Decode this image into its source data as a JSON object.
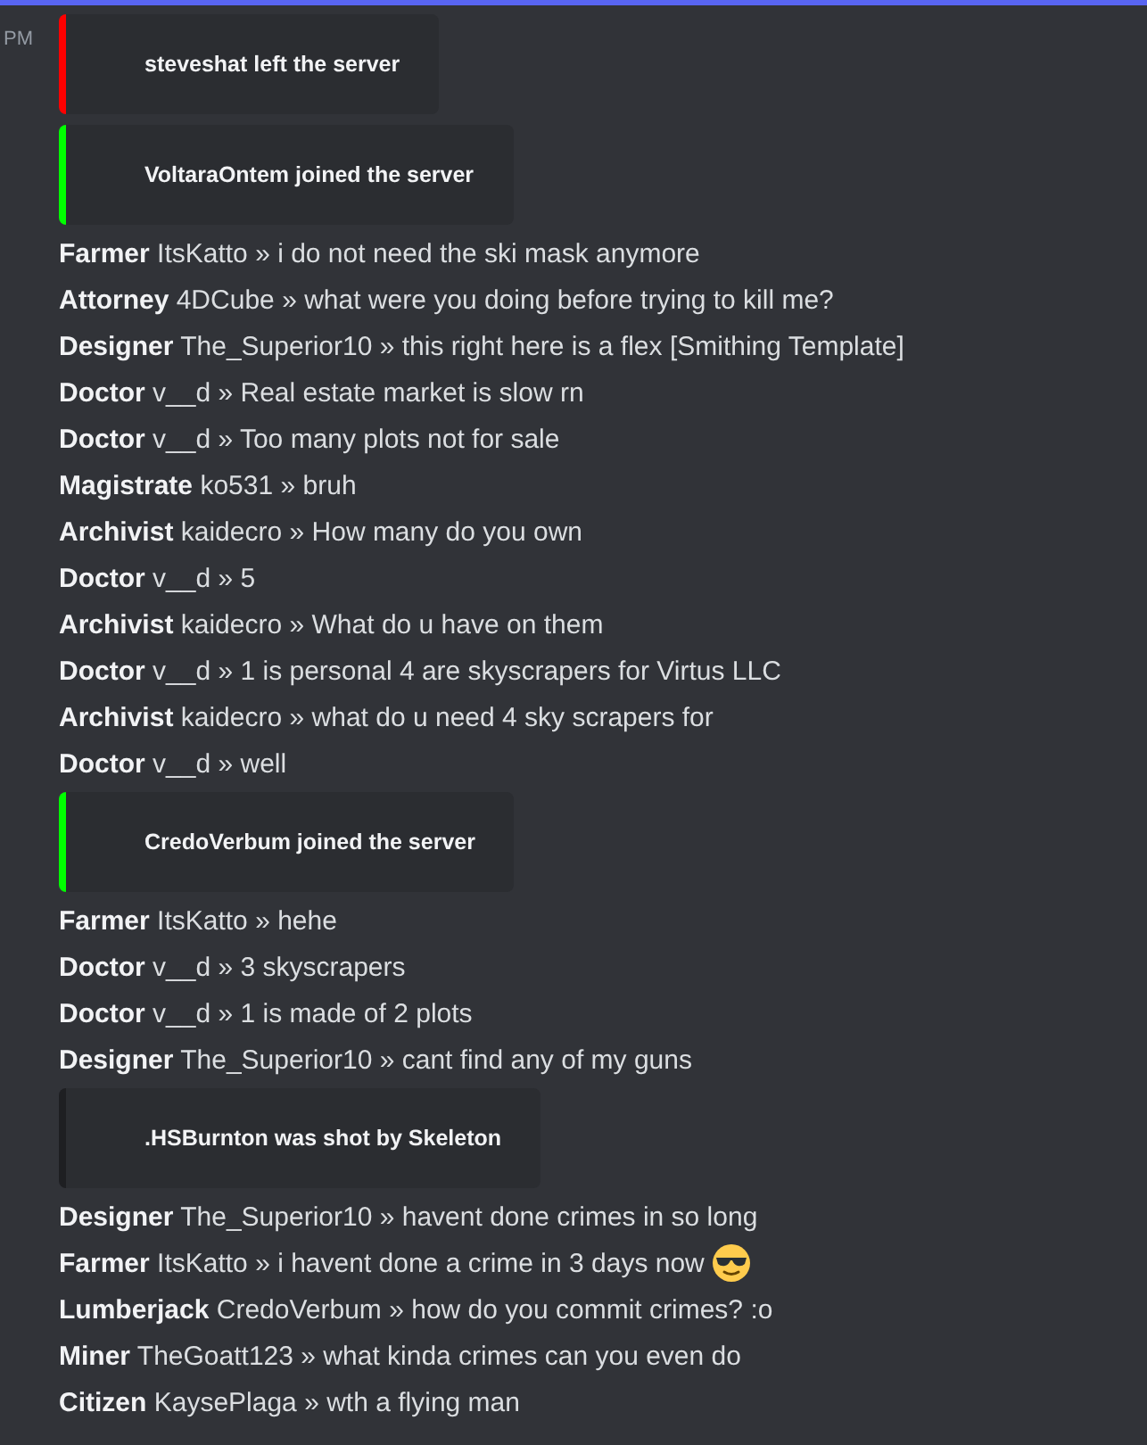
{
  "timestamp": "PM",
  "items": [
    {
      "kind": "embed",
      "text": "steveshat left the server",
      "color": "#ff0000"
    },
    {
      "kind": "embed",
      "text": "VoltaraOntem joined the server",
      "color": "#00ff00"
    },
    {
      "kind": "message",
      "role": "Farmer",
      "user": "ItsKatto",
      "separator": "»",
      "text": "i do not need the ski mask anymore"
    },
    {
      "kind": "message",
      "role": "Attorney",
      "user": "4DCube",
      "separator": "»",
      "text": "what were you doing before trying to kill me?"
    },
    {
      "kind": "message",
      "role": "Designer",
      "user": "The_Superior10",
      "separator": "»",
      "text": "this right here is a flex [Smithing Template]"
    },
    {
      "kind": "message",
      "role": "Doctor",
      "user": "v__d",
      "separator": "»",
      "text": "Real estate market is slow rn"
    },
    {
      "kind": "message",
      "role": "Doctor",
      "user": "v__d",
      "separator": "»",
      "text": "Too many plots not for sale"
    },
    {
      "kind": "message",
      "role": "Magistrate",
      "user": "ko531",
      "separator": "»",
      "text": "bruh"
    },
    {
      "kind": "message",
      "role": "Archivist",
      "user": "kaidecro",
      "separator": "»",
      "text": "How many do you own"
    },
    {
      "kind": "message",
      "role": "Doctor",
      "user": "v__d",
      "separator": "»",
      "text": "5"
    },
    {
      "kind": "message",
      "role": "Archivist",
      "user": "kaidecro",
      "separator": "»",
      "text": "What do u have on them"
    },
    {
      "kind": "message",
      "role": "Doctor",
      "user": "v__d",
      "separator": "»",
      "text": "1 is personal 4 are skyscrapers for Virtus LLC"
    },
    {
      "kind": "message",
      "role": "Archivist",
      "user": "kaidecro",
      "separator": "»",
      "text": "what do u need 4 sky scrapers for"
    },
    {
      "kind": "message",
      "role": "Doctor",
      "user": "v__d",
      "separator": "»",
      "text": "well"
    },
    {
      "kind": "embed",
      "text": "CredoVerbum joined the server",
      "color": "#00ff00"
    },
    {
      "kind": "message",
      "role": "Farmer",
      "user": "ItsKatto",
      "separator": "»",
      "text": "hehe"
    },
    {
      "kind": "message",
      "role": "Doctor",
      "user": "v__d",
      "separator": "»",
      "text": "3 skyscrapers"
    },
    {
      "kind": "message",
      "role": "Doctor",
      "user": "v__d",
      "separator": "»",
      "text": "1 is made of 2 plots"
    },
    {
      "kind": "message",
      "role": "Designer",
      "user": "The_Superior10",
      "separator": "»",
      "text": "cant find any of my guns"
    },
    {
      "kind": "embed",
      "text": ".HSBurnton was shot by Skeleton",
      "color": "#1e1f22"
    },
    {
      "kind": "message",
      "role": "Designer",
      "user": "The_Superior10",
      "separator": "»",
      "text": "havent done crimes in so long"
    },
    {
      "kind": "message",
      "role": "Farmer",
      "user": "ItsKatto",
      "separator": "»",
      "text": "i havent done a crime in 3 days now",
      "emoji": true
    },
    {
      "kind": "message",
      "role": "Lumberjack",
      "user": "CredoVerbum",
      "separator": "»",
      "text": "how do you commit crimes? :o"
    },
    {
      "kind": "message",
      "role": "Miner",
      "user": "TheGoatt123",
      "separator": "»",
      "text": "what kinda crimes can you even do"
    },
    {
      "kind": "message",
      "role": "Citizen",
      "user": "KaysePlaga",
      "separator": "»",
      "text": "wth a flying man"
    }
  ]
}
